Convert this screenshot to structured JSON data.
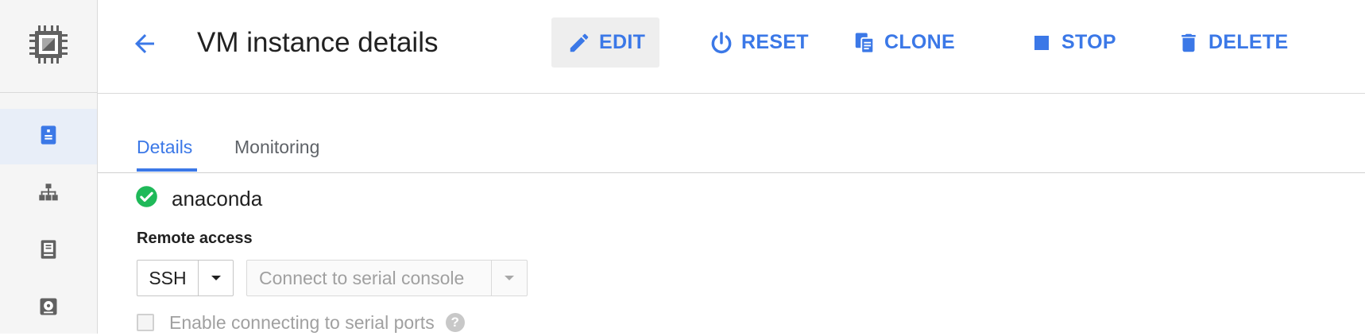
{
  "header": {
    "title": "VM instance details",
    "actions": [
      {
        "id": "edit",
        "label": "EDIT",
        "icon": "pencil-icon"
      },
      {
        "id": "reset",
        "label": "RESET",
        "icon": "power-icon"
      },
      {
        "id": "clone",
        "label": "CLONE",
        "icon": "copy-icon"
      },
      {
        "id": "stop",
        "label": "STOP",
        "icon": "stop-icon"
      },
      {
        "id": "delete",
        "label": "DELETE",
        "icon": "trash-icon"
      }
    ]
  },
  "rail": {
    "logo_icon": "chip-icon",
    "items": [
      {
        "icon": "vm-instance-icon",
        "active": true
      },
      {
        "icon": "instance-group-icon",
        "active": false
      },
      {
        "icon": "template-icon",
        "active": false
      },
      {
        "icon": "disk-icon",
        "active": false
      }
    ]
  },
  "tabs": [
    {
      "label": "Details",
      "active": true
    },
    {
      "label": "Monitoring",
      "active": false
    }
  ],
  "instance": {
    "name": "anaconda",
    "status_icon": "check-circle-icon"
  },
  "remote_access": {
    "label": "Remote access",
    "ssh_label": "SSH",
    "serial_console_label": "Connect to serial console",
    "serial_ports_checkbox_label": "Enable connecting to serial ports",
    "serial_ports_enabled": false
  },
  "colors": {
    "accent": "#3b78e7",
    "status_ok": "#1fb959",
    "rail_background": "#f5f5f5",
    "icon_gray": "#616161"
  }
}
